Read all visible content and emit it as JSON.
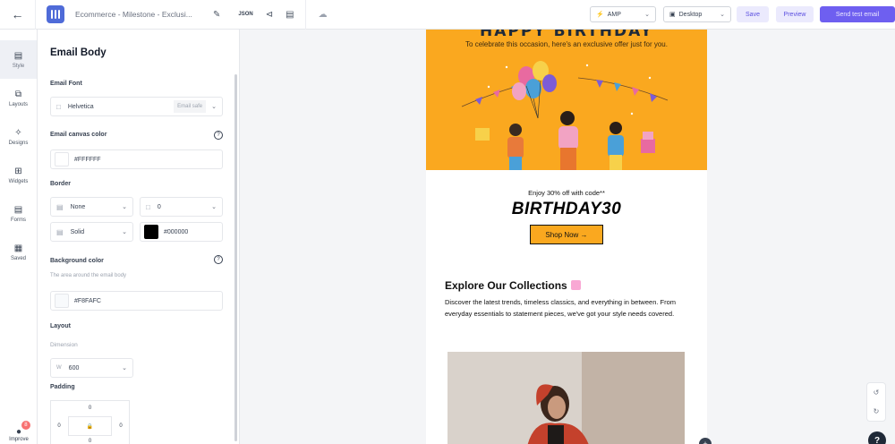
{
  "header": {
    "doc_title": "Ecommerce - Milestone - Exclusi...",
    "json_label": "JSON",
    "amp_label": "AMP",
    "device_label": "Desktop",
    "save_label": "Save",
    "preview_label": "Preview",
    "send_test_label": "Send test email"
  },
  "leftnav": {
    "items": [
      {
        "label": "Style"
      },
      {
        "label": "Layouts"
      },
      {
        "label": "Designs"
      },
      {
        "label": "Widgets"
      },
      {
        "label": "Forms"
      },
      {
        "label": "Saved"
      }
    ],
    "improve_label": "Improve",
    "improve_badge": "8"
  },
  "panel": {
    "title": "Email Body",
    "email_font": {
      "label": "Email Font",
      "value": "Helvetica",
      "tag": "Email safe"
    },
    "canvas_color": {
      "label": "Email canvas color",
      "value": "#FFFFFF",
      "swatch": "#FFFFFF"
    },
    "border": {
      "label": "Border",
      "width_select": "None",
      "width_value": "0",
      "style_select": "Solid",
      "color_value": "#000000",
      "color_swatch": "#000000"
    },
    "background": {
      "label": "Background color",
      "sub": "The area around the email body",
      "value": "#F8FAFC",
      "swatch": "#F8FAFC"
    },
    "layout": {
      "label": "Layout",
      "dimension_label": "Dimension",
      "width_prefix": "W",
      "width_value": "600"
    },
    "padding": {
      "label": "Padding",
      "top": "0",
      "left": "0",
      "right": "0",
      "bottom": "0"
    }
  },
  "email": {
    "hero_title": "HAPPY BIRTHDAY",
    "hero_sub": "To celebrate this occasion, here's an exclusive offer just for you.",
    "offer_text": "Enjoy 30% off with code**",
    "code": "BIRTHDAY30",
    "shop_button": "Shop Now →",
    "explore_title": "Explore Our Collections",
    "explore_desc": "Discover the latest trends, timeless classics, and everything in between. From everyday essentials to statement pieces, we've got your style needs covered."
  },
  "colors": {
    "accent": "#6e5ff0",
    "hero_bg": "#faa81f"
  }
}
